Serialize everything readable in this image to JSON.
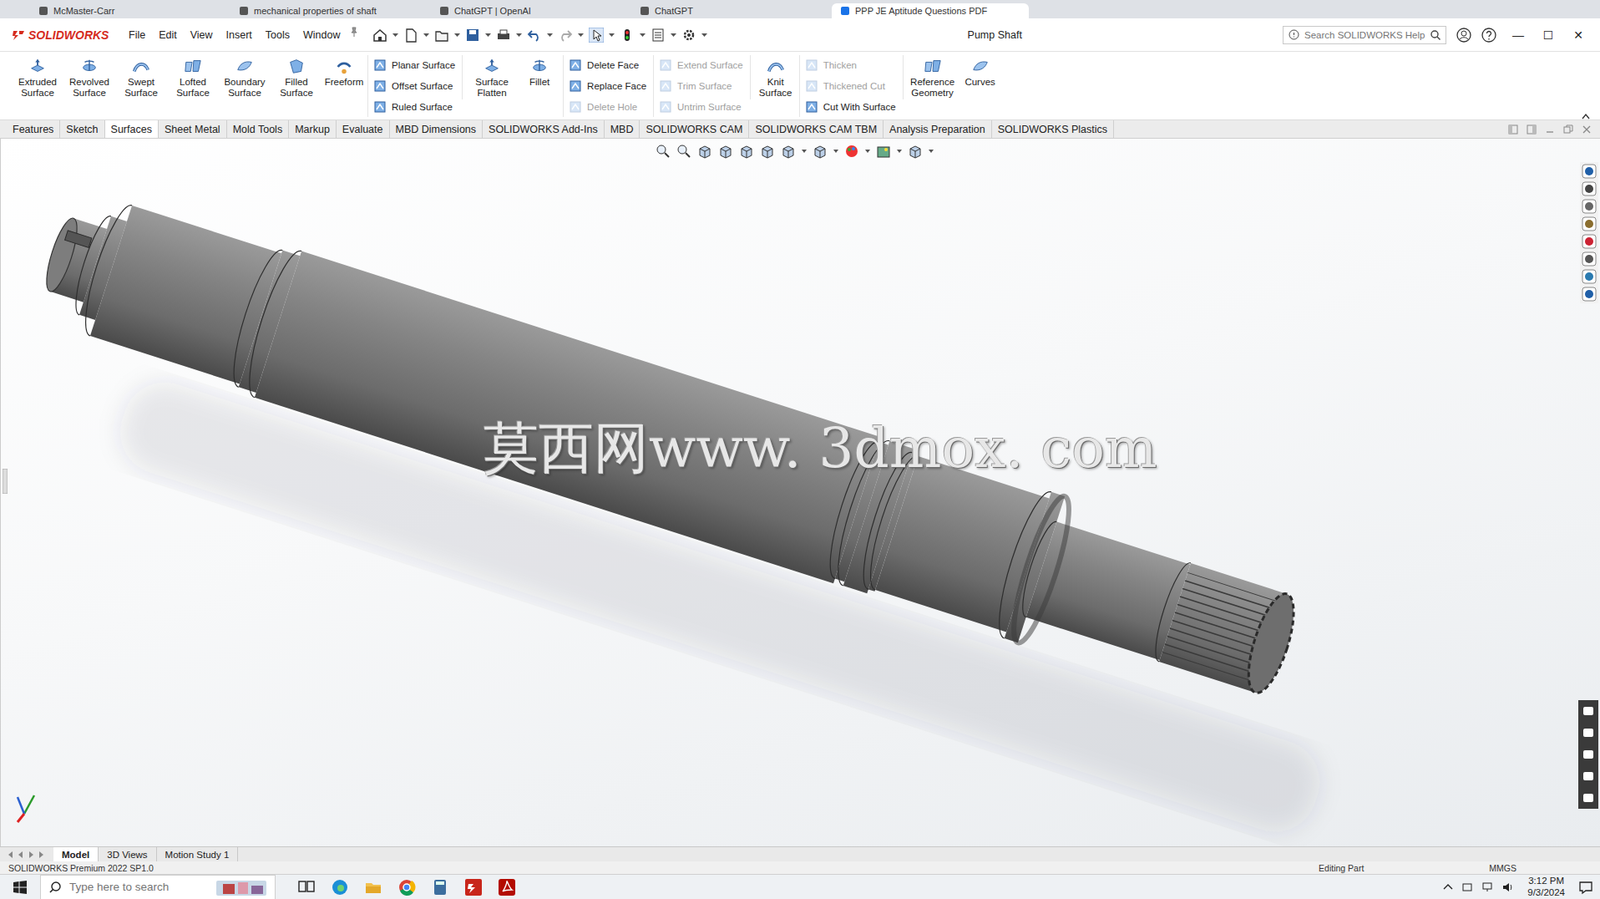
{
  "browser_tabs": [
    {
      "label": "McMaster-Carr",
      "selected": false
    },
    {
      "label": "mechanical properties of shaft",
      "selected": false
    },
    {
      "label": "ChatGPT | OpenAI",
      "selected": false
    },
    {
      "label": "ChatGPT",
      "selected": false
    },
    {
      "label": "PPP JE Aptitude Questions PDF",
      "selected": true
    }
  ],
  "window": {
    "logo": "SOLIDWORKS",
    "title": "Pump Shaft",
    "controls": [
      "—",
      "☐",
      "✕"
    ]
  },
  "menu": [
    {
      "label": "File"
    },
    {
      "label": "Edit"
    },
    {
      "label": "View"
    },
    {
      "label": "Insert"
    },
    {
      "label": "Tools"
    },
    {
      "label": "Window"
    }
  ],
  "search": {
    "placeholder": "Search SOLIDWORKS Help"
  },
  "ribbon": [
    {
      "kind": "large",
      "items": [
        {
          "label": "Extruded Surface",
          "disabled": false
        },
        {
          "label": "Revolved Surface",
          "disabled": false
        },
        {
          "label": "Swept Surface",
          "disabled": false
        },
        {
          "label": "Lofted Surface",
          "disabled": false
        },
        {
          "label": "Boundary Surface",
          "disabled": false
        },
        {
          "label": "Filled Surface",
          "disabled": false
        },
        {
          "label": "Freeform",
          "disabled": false
        }
      ]
    },
    {
      "kind": "stack",
      "items": [
        {
          "label": "Planar Surface",
          "disabled": false
        },
        {
          "label": "Offset Surface",
          "disabled": false
        },
        {
          "label": "Ruled Surface",
          "disabled": false
        }
      ]
    },
    {
      "kind": "large",
      "items": [
        {
          "label": "Surface Flatten",
          "disabled": false
        },
        {
          "label": "Fillet",
          "disabled": false
        }
      ]
    },
    {
      "kind": "stack",
      "items": [
        {
          "label": "Delete Face",
          "disabled": false
        },
        {
          "label": "Replace Face",
          "disabled": false
        },
        {
          "label": "Delete Hole",
          "disabled": true
        }
      ]
    },
    {
      "kind": "stack",
      "items": [
        {
          "label": "Extend Surface",
          "disabled": true
        },
        {
          "label": "Trim Surface",
          "disabled": true
        },
        {
          "label": "Untrim Surface",
          "disabled": true
        }
      ]
    },
    {
      "kind": "large",
      "items": [
        {
          "label": "Knit Surface",
          "disabled": false
        }
      ]
    },
    {
      "kind": "stack",
      "items": [
        {
          "label": "Thicken",
          "disabled": true
        },
        {
          "label": "Thickened Cut",
          "disabled": true
        },
        {
          "label": "Cut With Surface",
          "disabled": false
        }
      ]
    },
    {
      "kind": "large",
      "items": [
        {
          "label": "Reference Geometry",
          "disabled": false
        },
        {
          "label": "Curves",
          "disabled": false
        }
      ]
    }
  ],
  "command_tabs": [
    {
      "label": "Features",
      "selected": false
    },
    {
      "label": "Sketch",
      "selected": false
    },
    {
      "label": "Surfaces",
      "selected": true
    },
    {
      "label": "Sheet Metal",
      "selected": false
    },
    {
      "label": "Mold Tools",
      "selected": false
    },
    {
      "label": "Markup",
      "selected": false
    },
    {
      "label": "Evaluate",
      "selected": false
    },
    {
      "label": "MBD Dimensions",
      "selected": false
    },
    {
      "label": "SOLIDWORKS Add-Ins",
      "selected": false
    },
    {
      "label": "MBD",
      "selected": false
    },
    {
      "label": "SOLIDWORKS CAM",
      "selected": false
    },
    {
      "label": "SOLIDWORKS CAM TBM",
      "selected": false
    },
    {
      "label": "Analysis Preparation",
      "selected": false
    },
    {
      "label": "SOLIDWORKS Plastics",
      "selected": false
    }
  ],
  "viewport": {
    "watermark": "莫西网www. 3dmox. com"
  },
  "bottom_tabs": [
    {
      "label": "Model",
      "selected": true
    },
    {
      "label": "3D Views",
      "selected": false
    },
    {
      "label": "Motion Study 1",
      "selected": false
    }
  ],
  "status_bar": {
    "product": "SOLIDWORKS Premium 2022 SP1.0",
    "mode": "Editing Part",
    "units": "MMGS"
  },
  "taskbar": {
    "search_placeholder": "Type here to search",
    "time": "3:12 PM",
    "date": "9/3/2024"
  }
}
